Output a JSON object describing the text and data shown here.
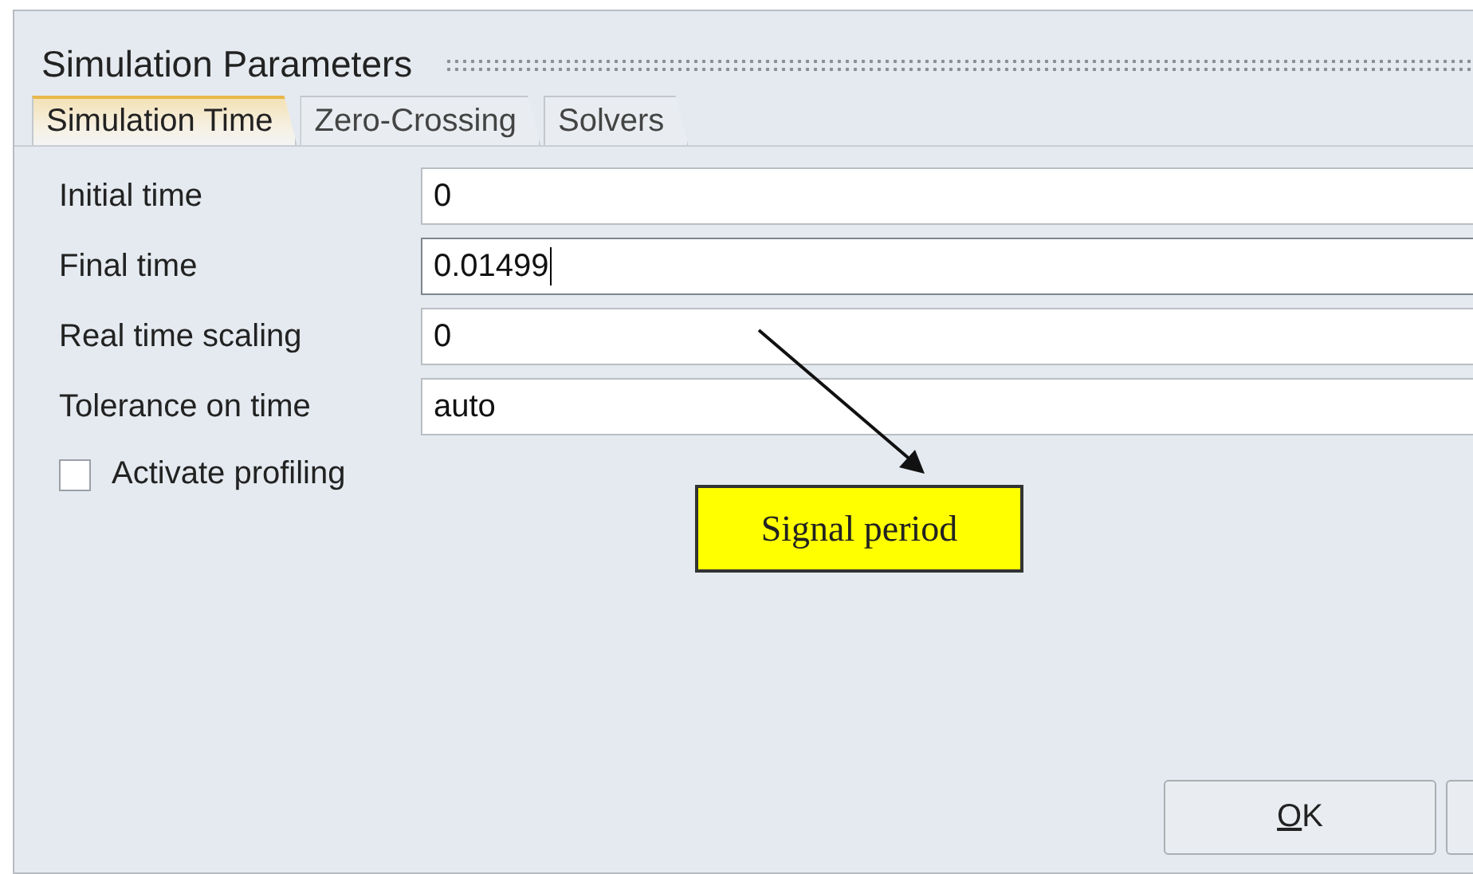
{
  "dialog": {
    "title": "Simulation Parameters"
  },
  "tabs": [
    {
      "label": "Simulation Time",
      "selected": true
    },
    {
      "label": "Zero-Crossing",
      "selected": false
    },
    {
      "label": "Solvers",
      "selected": false
    }
  ],
  "fields": [
    {
      "label": "Initial time",
      "value": "0",
      "focused": false
    },
    {
      "label": "Final time",
      "value": "0.01499",
      "focused": true
    },
    {
      "label": "Real time scaling",
      "value": "0",
      "focused": false
    },
    {
      "label": "Tolerance on time",
      "value": "auto",
      "focused": false
    }
  ],
  "checkbox": {
    "label": "Activate profiling",
    "checked": false
  },
  "annotation": {
    "text": "Signal period"
  },
  "buttons": [
    "OK"
  ]
}
